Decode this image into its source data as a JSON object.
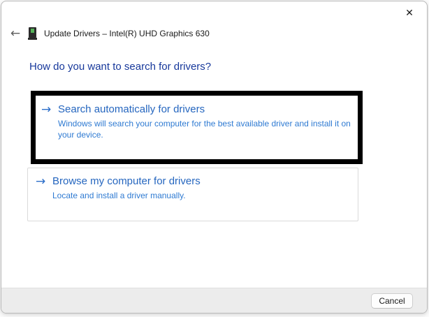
{
  "window": {
    "title": "Update Drivers – Intel(R) UHD Graphics 630"
  },
  "icons": {
    "close": "✕",
    "back": "←",
    "forward": "→",
    "device_icon_name": "display-adapter-icon"
  },
  "heading": "How do you want to search for drivers?",
  "options": [
    {
      "title": "Search automatically for drivers",
      "description": "Windows will search your computer for the best available driver and install it on your device.",
      "highlighted": true
    },
    {
      "title": "Browse my computer for drivers",
      "description": "Locate and install a driver manually.",
      "highlighted": false
    }
  ],
  "footer": {
    "cancel_label": "Cancel"
  },
  "colors": {
    "heading_text": "#17389b",
    "link_title": "#2566bf",
    "link_description": "#2e7ad2",
    "highlight_border": "#000000",
    "footer_background": "#ececec",
    "device_icon_green": "#55b258"
  }
}
